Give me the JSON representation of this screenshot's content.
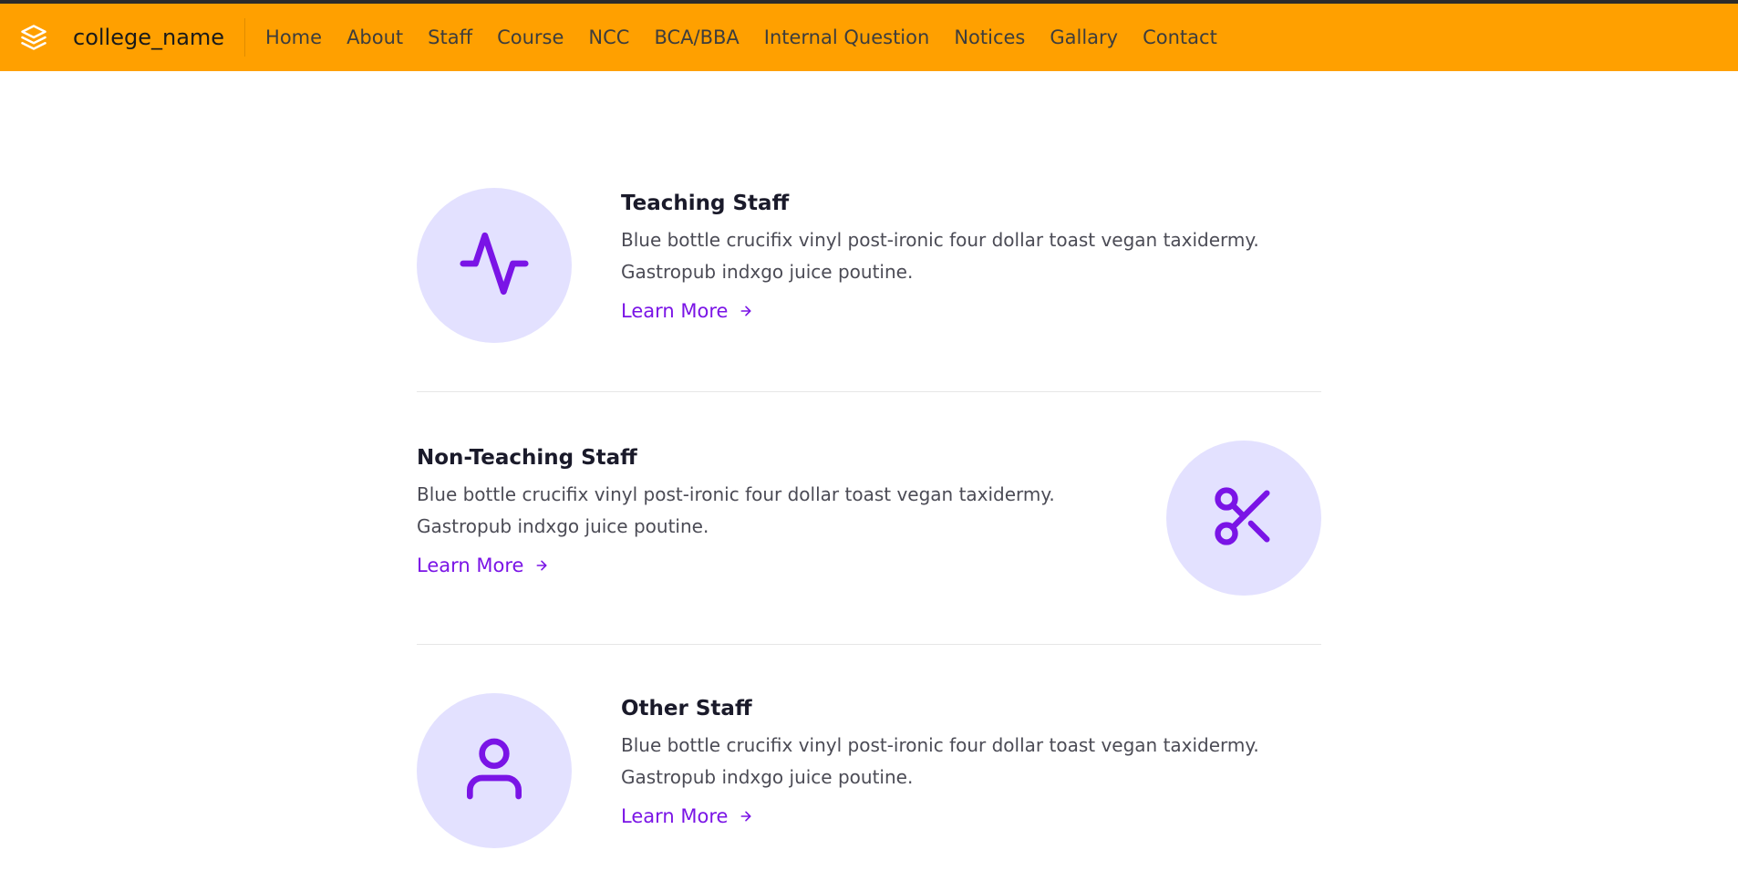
{
  "navbar": {
    "brand": "college_name",
    "links": [
      "Home",
      "About",
      "Staff",
      "Course",
      "NCC",
      "BCA/BBA",
      "Internal Question",
      "Notices",
      "Gallary",
      "Contact"
    ]
  },
  "colors": {
    "navbar_bg": "#ffa000",
    "accent": "#7a14e6",
    "icon_circle_bg": "#e3e1ff"
  },
  "sections": [
    {
      "title": "Teaching Staff",
      "desc_line1": "Blue bottle crucifix vinyl post-ironic four dollar toast vegan taxidermy.",
      "desc_line2": "Gastropub indxgo juice poutine.",
      "link": "Learn More",
      "icon": "activity-icon"
    },
    {
      "title": "Non-Teaching Staff",
      "desc_line1": "Blue bottle crucifix vinyl post-ironic four dollar toast vegan taxidermy.",
      "desc_line2": "Gastropub indxgo juice poutine.",
      "link": "Learn More",
      "icon": "scissors-icon"
    },
    {
      "title": "Other Staff",
      "desc_line1": "Blue bottle crucifix vinyl post-ironic four dollar toast vegan taxidermy.",
      "desc_line2": "Gastropub indxgo juice poutine.",
      "link": "Learn More",
      "icon": "user-icon"
    }
  ]
}
